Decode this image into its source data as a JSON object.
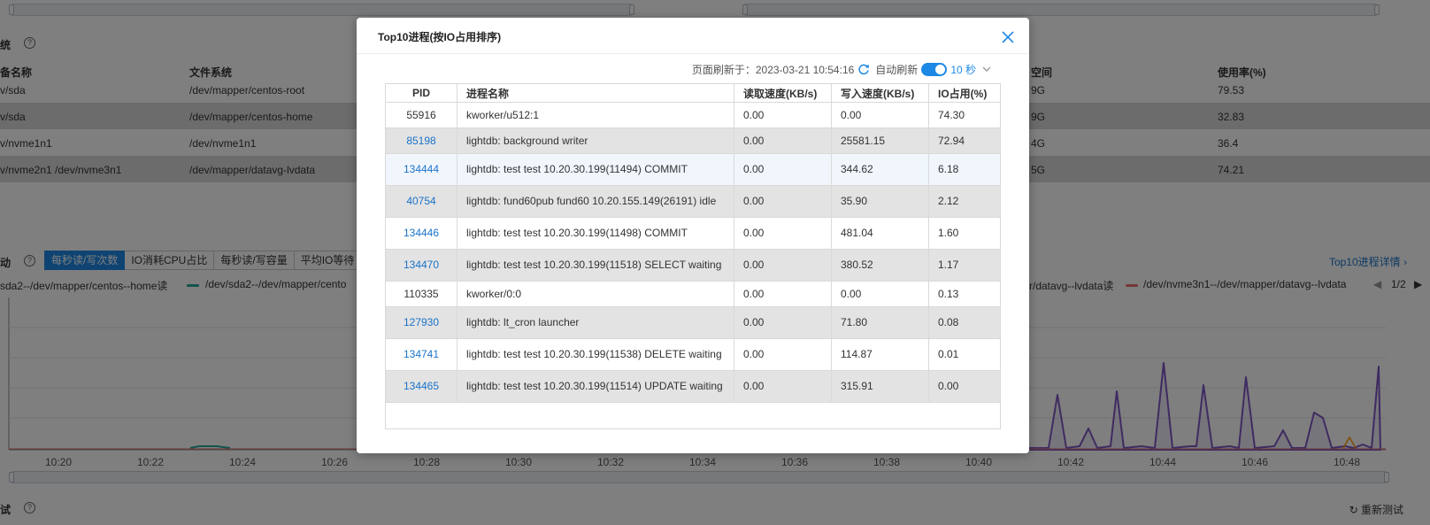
{
  "background": {
    "disk_section_title": "统",
    "disk_headers": [
      "备名称",
      "文件系统",
      "空间",
      "使用率(%)"
    ],
    "disk_rows": [
      {
        "device": "v/sda",
        "fs": "/dev/mapper/centos-root",
        "space": "9G",
        "usage": "79.53"
      },
      {
        "device": "v/sda",
        "fs": "/dev/mapper/centos-home",
        "space": "9G",
        "usage": "32.83"
      },
      {
        "device": "v/nvme1n1",
        "fs": "/dev/nvme1n1",
        "space": "4G",
        "usage": "36.4"
      },
      {
        "device": "v/nvme2n1 /dev/nvme3n1",
        "fs": "/dev/mapper/datavg-lvdata",
        "space": "5G",
        "usage": "74.21"
      }
    ],
    "io_section_title": "动",
    "tabs": [
      "每秒读/写次数",
      "IO消耗CPU占比",
      "每秒读/写容量",
      "平均IO等待"
    ],
    "top10_link": "Top10进程详情",
    "legend_left": "sda2--/dev/mapper/centos--home读",
    "legend_mid": "/dev/sda2--/dev/mapper/cento",
    "legend_right_a": "r/datavg--lvdata读",
    "legend_right_b": "/dev/nvme3n1--/dev/mapper/datavg--lvdata",
    "legend_page": "1/2",
    "x_ticks": [
      "10:20",
      "10:22",
      "10:24",
      "10:26",
      "10:28",
      "10:30",
      "10:32",
      "10:34",
      "10:36",
      "10:38",
      "10:40",
      "10:42",
      "10:44",
      "10:46",
      "10:48"
    ],
    "bottom_section_title": "试",
    "retest_label": "重新测试",
    "colors": {
      "series_purple": "#7e57c2",
      "series_teal": "#26a69a",
      "series_orange": "#ff9800",
      "series_red": "#e57373"
    }
  },
  "dialog": {
    "title": "Top10进程(按IO占用排序)",
    "refresh_label": "页面刷新于：2023-03-21 10:54:16",
    "auto_refresh_label": "自动刷新",
    "auto_refresh_on": true,
    "interval": "10 秒",
    "columns": [
      "PID",
      "进程名称",
      "读取速度(KB/s)",
      "写入速度(KB/s)",
      "IO占用(%)"
    ],
    "rows": [
      {
        "pid": "55916",
        "link": false,
        "name": "kworker/u512:1",
        "read": "0.00",
        "write": "0.00",
        "io": "74.30"
      },
      {
        "pid": "85198",
        "link": true,
        "name": "lightdb: background writer",
        "read": "0.00",
        "write": "25581.15",
        "io": "72.94"
      },
      {
        "pid": "134444",
        "link": true,
        "name": "lightdb: test test 10.20.30.199(11494) COMMIT",
        "read": "0.00",
        "write": "344.62",
        "io": "6.18"
      },
      {
        "pid": "40754",
        "link": true,
        "name": "lightdb: fund60pub fund60 10.20.155.149(26191) idle",
        "read": "0.00",
        "write": "35.90",
        "io": "2.12"
      },
      {
        "pid": "134446",
        "link": true,
        "name": "lightdb: test test 10.20.30.199(11498) COMMIT",
        "read": "0.00",
        "write": "481.04",
        "io": "1.60"
      },
      {
        "pid": "134470",
        "link": true,
        "name": "lightdb: test test 10.20.30.199(11518) SELECT waiting",
        "read": "0.00",
        "write": "380.52",
        "io": "1.17"
      },
      {
        "pid": "110335",
        "link": false,
        "name": "kworker/0:0",
        "read": "0.00",
        "write": "0.00",
        "io": "0.13"
      },
      {
        "pid": "127930",
        "link": true,
        "name": "lightdb: lt_cron launcher",
        "read": "0.00",
        "write": "71.80",
        "io": "0.08"
      },
      {
        "pid": "134741",
        "link": true,
        "name": "lightdb: test test 10.20.30.199(11538) DELETE waiting",
        "read": "0.00",
        "write": "114.87",
        "io": "0.01"
      },
      {
        "pid": "134465",
        "link": true,
        "name": "lightdb: test test 10.20.30.199(11514) UPDATE waiting",
        "read": "0.00",
        "write": "315.91",
        "io": "0.00"
      }
    ]
  }
}
